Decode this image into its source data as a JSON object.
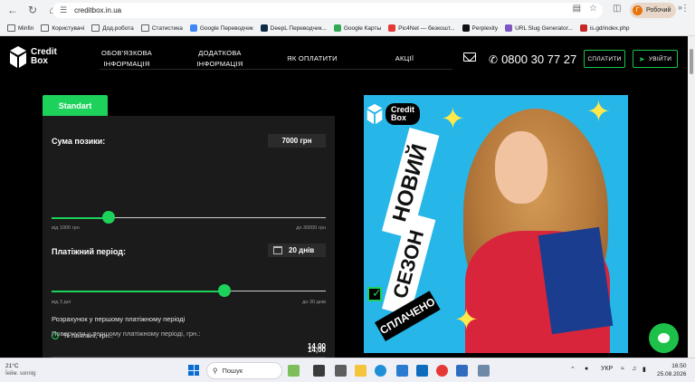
{
  "browser": {
    "url": "creditbox.in.ua",
    "profile_label": "Робочий",
    "profile_initial": "Г",
    "bookmarks": [
      {
        "label": "Minfin",
        "kind": "folder"
      },
      {
        "label": "Користувачі",
        "kind": "folder"
      },
      {
        "label": "Дод.робота",
        "kind": "folder"
      },
      {
        "label": "Статистика",
        "kind": "folder"
      },
      {
        "label": "Google Переводчик",
        "kind": "fav",
        "color": "#4285f4"
      },
      {
        "label": "DeepL Переводчик...",
        "kind": "fav",
        "color": "#0f2b46"
      },
      {
        "label": "Google Карты",
        "kind": "fav",
        "color": "#34a853"
      },
      {
        "label": "Pic4Net — безкошт...",
        "kind": "fav",
        "color": "#e53935"
      },
      {
        "label": "Perplexity",
        "kind": "fav",
        "color": "#111111"
      },
      {
        "label": "URL Slug Generator...",
        "kind": "fav",
        "color": "#7e57c2"
      },
      {
        "label": "is.gd/index.php",
        "kind": "fav",
        "color": "#c62828"
      }
    ],
    "bookmarks_more": "»"
  },
  "site": {
    "logo_line1": "Credit",
    "logo_line2": "Box",
    "menu": [
      {
        "line1": "ОБОВ'ЯЗКОВА",
        "line2": "ІНФОРМАЦІЯ"
      },
      {
        "line1": "ДОДАТКОВА",
        "line2": "ІНФОРМАЦІЯ"
      },
      {
        "line1": "ЯК ОПЛАТИТИ",
        "line2": ""
      },
      {
        "line1": "АКЦІЇ",
        "line2": ""
      }
    ],
    "phone": "0800 30 77 27",
    "pay_button": "СПЛАТИТИ",
    "login_button": "УВІЙТИ",
    "accent": "#1dd25b"
  },
  "calculator": {
    "tab": "Standart",
    "amount_label": "Сума позики:",
    "amount_value": "7000 грн",
    "amount_min": "від 1000 грн",
    "amount_max": "до 30000 грн",
    "amount_fraction": 0.2069,
    "period_label": "Платіжний період:",
    "period_value": "20 днів",
    "period_min": "від 3 дні",
    "period_max": "до 30 днів",
    "period_fraction": 0.6296,
    "first_period_title": "Розрахунок у першому платіжному періоді",
    "loyal_label": "% лояльні, грн.:",
    "loyal_value": "14,00",
    "return_label": "Повернути у першому платіжному періоді, грн.:",
    "return_value": "14,00"
  },
  "banner": {
    "logo_line1": "Credit",
    "logo_line2": "Box",
    "stripe1": "НОВИЙ",
    "stripe2": "СЕЗОН",
    "stripe3": "СПЛАЧЕНО"
  },
  "taskbar": {
    "weather_temp": "21°C",
    "weather_text": "Їейм. sonnig",
    "search_placeholder": "Пошук",
    "lang": "УКР",
    "time": "16:50",
    "date": "25.08.2026"
  }
}
